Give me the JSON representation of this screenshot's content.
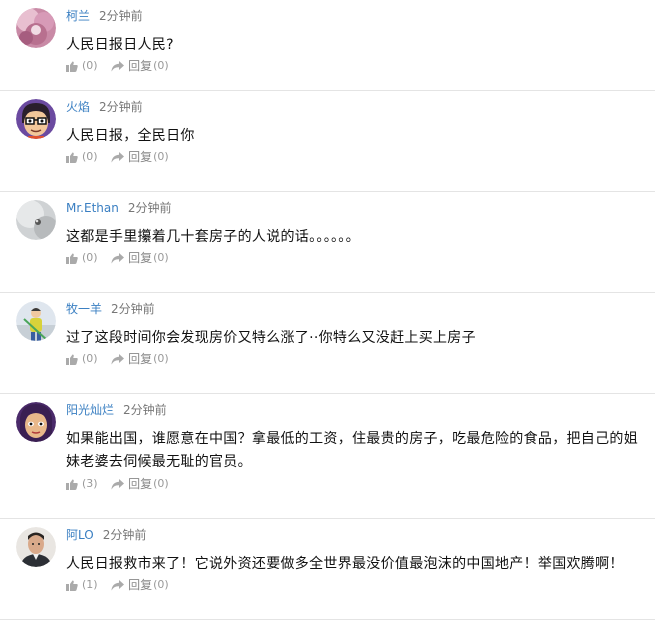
{
  "comments": [
    {
      "username": "柯兰",
      "time": "2分钟前",
      "text": "人民日报日人民?",
      "likes": "(0)",
      "reply_label": "回复",
      "replies": "(0)",
      "avatar_icon": "pink-flower-avatar-icon"
    },
    {
      "username": "火焰",
      "time": "2分钟前",
      "text": "人民日报，全民日你",
      "likes": "(0)",
      "reply_label": "回复",
      "replies": "(0)",
      "avatar_icon": "cartoon-man-glasses-avatar-icon"
    },
    {
      "username": "Mr.Ethan",
      "time": "2分钟前",
      "text": "这都是手里攥着几十套房子的人说的话。。。。。。",
      "likes": "(0)",
      "reply_label": "回复",
      "replies": "(0)",
      "avatar_icon": "grey-blur-avatar-icon"
    },
    {
      "username": "牧一羊",
      "time": "2分钟前",
      "text": "过了这段时间你会发现房价又特么涨了··你特么又没赶上买上房子",
      "likes": "(0)",
      "reply_label": "回复",
      "replies": "(0)",
      "avatar_icon": "person-outdoor-avatar-icon"
    },
    {
      "username": "阳光灿烂",
      "time": "2分钟前",
      "text": "如果能出国，谁愿意在中国？拿最低的工资，住最贵的房子，吃最危险的食品，把自己的姐妹老婆去伺候最无耻的官员。",
      "likes": "(3)",
      "reply_label": "回复",
      "replies": "(0)",
      "avatar_icon": "cartoon-woman-purple-hair-avatar-icon"
    },
    {
      "username": "阿LO",
      "time": "2分钟前",
      "text": "人民日报救市来了！它说外资还要做多全世界最没价值最泡沫的中国地产！举国欢腾啊！",
      "likes": "(1)",
      "reply_label": "回复",
      "replies": "(0)",
      "avatar_icon": "man-photo-avatar-icon"
    }
  ],
  "colors": {
    "username": "#3a7fc2",
    "time": "#777777",
    "text": "#111111",
    "muted": "#999999",
    "divider": "#e4e4e4"
  }
}
